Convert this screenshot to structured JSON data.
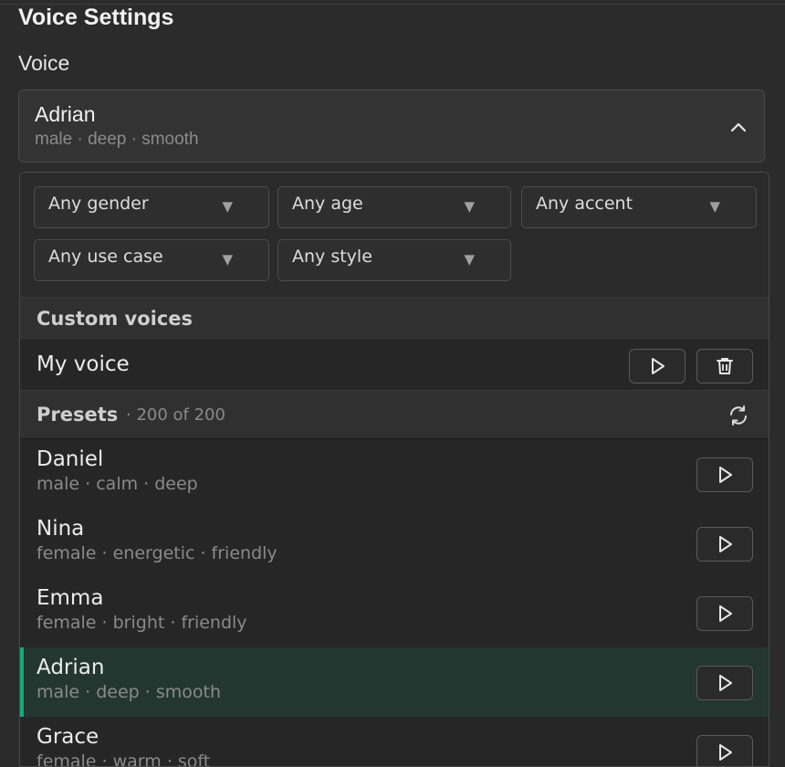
{
  "title": "Voice Settings",
  "voice_label": "Voice",
  "selected": {
    "name": "Adrian",
    "tags": "male · deep · smooth"
  },
  "filters": [
    {
      "label": "Any gender"
    },
    {
      "label": "Any age"
    },
    {
      "label": "Any accent"
    },
    {
      "label": "Any use case"
    },
    {
      "label": "Any style"
    }
  ],
  "custom": {
    "title": "Custom voices",
    "items": [
      {
        "name": "My voice"
      }
    ]
  },
  "presets": {
    "title": "Presets",
    "count": "· 200 of 200",
    "items": [
      {
        "name": "Daniel",
        "tags": "male · calm · deep"
      },
      {
        "name": "Nina",
        "tags": "female · energetic · friendly"
      },
      {
        "name": "Emma",
        "tags": "female · bright · friendly"
      },
      {
        "name": "Adrian",
        "tags": "male · deep · smooth"
      },
      {
        "name": "Grace",
        "tags": "female · warm · soft"
      }
    ]
  },
  "colors": {
    "accent": "#16a87d",
    "selected_row": "#233630",
    "background": "#2b2b2b"
  },
  "icons": {
    "collapse": "chevron-up-icon",
    "filter_arrow": "triangle-down-icon",
    "play": "play-icon",
    "delete": "trash-icon",
    "refresh": "refresh-icon"
  }
}
